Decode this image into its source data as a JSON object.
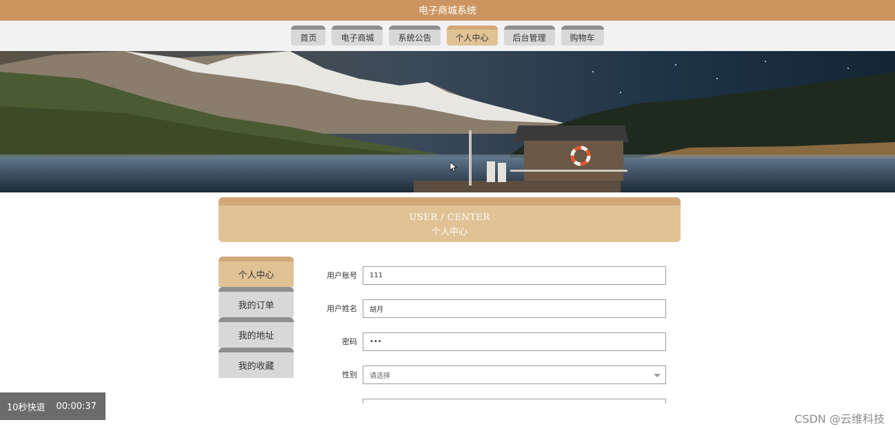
{
  "app": {
    "title": "电子商城系统"
  },
  "nav": {
    "items": [
      {
        "label": "首页",
        "active": false
      },
      {
        "label": "电子商城",
        "active": false
      },
      {
        "label": "系统公告",
        "active": false
      },
      {
        "label": "个人中心",
        "active": true
      },
      {
        "label": "后台管理",
        "active": false
      },
      {
        "label": "购物车",
        "active": false
      }
    ]
  },
  "section_header": {
    "en": "USER / CENTER",
    "cn": "个人中心"
  },
  "sidebar": {
    "items": [
      {
        "label": "个人中心",
        "active": true
      },
      {
        "label": "我的订单",
        "active": false
      },
      {
        "label": "我的地址",
        "active": false
      },
      {
        "label": "我的收藏",
        "active": false
      }
    ]
  },
  "form": {
    "account": {
      "label": "用户账号",
      "value": "111"
    },
    "name": {
      "label": "用户姓名",
      "value": "胡月"
    },
    "password": {
      "label": "密码",
      "value": "•••"
    },
    "gender": {
      "label": "性别",
      "placeholder": "请选择"
    }
  },
  "overlay": {
    "text": "10秒快退",
    "time": "00:00:37"
  },
  "watermark": {
    "text": "CSDN @云维科技"
  },
  "colors": {
    "accent": "#cc9560",
    "active_tab": "#e0c295",
    "tab_inactive": "#d8d8d8"
  }
}
